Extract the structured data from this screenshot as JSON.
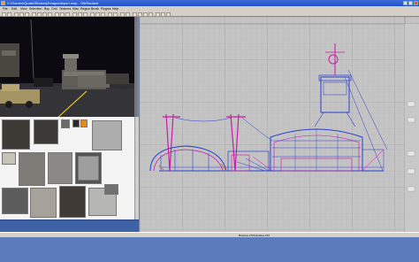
{
  "window": {
    "title": "C:\\Games\\Quake3\\baseq3\\maps\\airport.map - GtkRadiant"
  },
  "menubar": {
    "items": [
      "File",
      "Edit",
      "View",
      "Selection",
      "Bsp",
      "Grid",
      "Textures",
      "Misc",
      "Region",
      "Brush",
      "Plugins",
      "Help"
    ]
  },
  "statusbar": {
    "texture_info": "Brushes 2706 Entities 152"
  },
  "colors": {
    "grid_bg": "#c4c4c4",
    "brush_blue": "#2a3fd0",
    "entity_magenta": "#c81aa8",
    "orange_brush": "#d27a1a"
  }
}
